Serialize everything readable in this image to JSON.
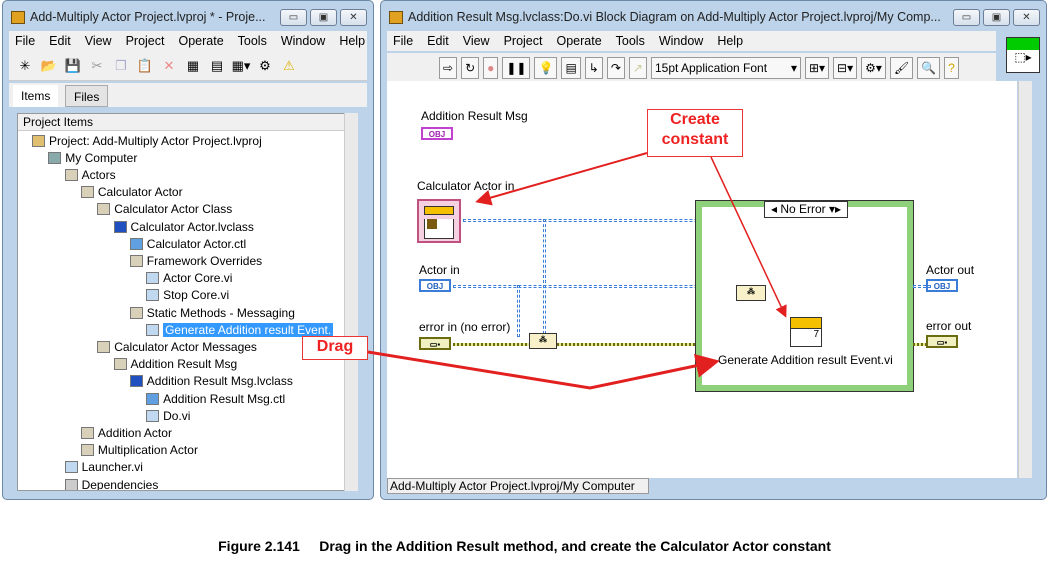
{
  "project_window": {
    "title": "Add-Multiply Actor Project.lvproj * - Proje...",
    "menu": [
      "File",
      "Edit",
      "View",
      "Project",
      "Operate",
      "Tools",
      "Window",
      "Help"
    ],
    "tabs": [
      "Items",
      "Files"
    ],
    "tree_header": "Project Items",
    "tree": [
      {
        "label": "Project: Add-Multiply Actor Project.lvproj",
        "depth": 0,
        "icon": "project-icon"
      },
      {
        "label": "My Computer",
        "depth": 1,
        "icon": "computer-icon"
      },
      {
        "label": "Actors",
        "depth": 2,
        "icon": "folder-icon"
      },
      {
        "label": "Calculator Actor",
        "depth": 3,
        "icon": "folder-icon"
      },
      {
        "label": "Calculator Actor Class",
        "depth": 4,
        "icon": "folder-icon"
      },
      {
        "label": "Calculator Actor.lvclass",
        "depth": 5,
        "icon": "class-icon"
      },
      {
        "label": "Calculator Actor.ctl",
        "depth": 6,
        "icon": "ctl-icon"
      },
      {
        "label": "Framework Overrides",
        "depth": 6,
        "icon": "folder-icon"
      },
      {
        "label": "Actor Core.vi",
        "depth": 7,
        "icon": "vi-icon"
      },
      {
        "label": "Stop Core.vi",
        "depth": 7,
        "icon": "vi-icon"
      },
      {
        "label": "Static Methods - Messaging",
        "depth": 6,
        "icon": "folder-icon"
      },
      {
        "label": "Generate Addition result Event.",
        "depth": 7,
        "icon": "vi-icon",
        "selected": true
      },
      {
        "label": "Calculator Actor Messages",
        "depth": 4,
        "icon": "folder-icon"
      },
      {
        "label": "Addition Result Msg",
        "depth": 5,
        "icon": "folder-icon"
      },
      {
        "label": "Addition Result Msg.lvclass",
        "depth": 6,
        "icon": "class-icon"
      },
      {
        "label": "Addition Result Msg.ctl",
        "depth": 7,
        "icon": "ctl-icon"
      },
      {
        "label": "Do.vi",
        "depth": 7,
        "icon": "vi-icon"
      },
      {
        "label": "Addition Actor",
        "depth": 3,
        "icon": "folder-icon"
      },
      {
        "label": "Multiplication Actor",
        "depth": 3,
        "icon": "folder-icon"
      },
      {
        "label": "Launcher.vi",
        "depth": 2,
        "icon": "vi-icon"
      },
      {
        "label": "Dependencies",
        "depth": 2,
        "icon": "dependencies-icon"
      }
    ]
  },
  "diagram_window": {
    "title": "Addition Result Msg.lvclass:Do.vi Block Diagram on Add-Multiply Actor Project.lvproj/My Comp...",
    "menu": [
      "File",
      "Edit",
      "View",
      "Project",
      "Operate",
      "Tools",
      "Window",
      "Help"
    ],
    "font_select": "15pt Application Font",
    "status": "Add-Multiply Actor Project.lvproj/My Computer",
    "labels": {
      "addition_result_msg": "Addition Result Msg",
      "calculator_actor_in": "Calculator Actor in",
      "actor_in": "Actor in",
      "error_in": "error in (no error)",
      "actor_out": "Actor out",
      "error_out": "error out",
      "case_selector": "No Error",
      "subvi": "Generate Addition result Event.vi",
      "subvi_terminal": "7",
      "obj": "OBJ"
    },
    "colors": {
      "class_wire": "#3a7dd8",
      "error_wire": "#6b6b10",
      "case_border": "#8fd07a"
    }
  },
  "annotations": {
    "create_constant": "Create constant",
    "drag": "Drag",
    "arrow_color": "#e32020"
  },
  "caption": "Figure 2.141     Drag in the Addition Result method, and create the Calculator Actor constant"
}
